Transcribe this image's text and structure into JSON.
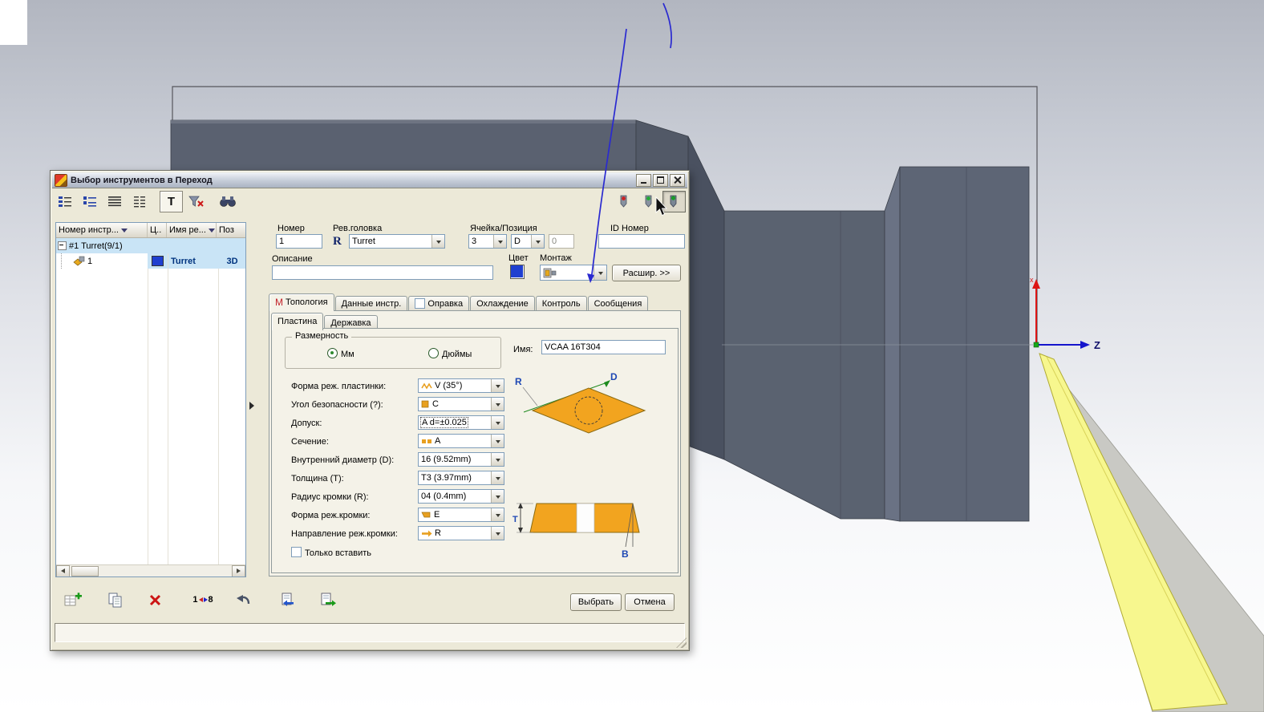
{
  "window": {
    "title": "Выбор инструментов в Переход"
  },
  "scene": {
    "z_label": "Z",
    "x_label": "x"
  },
  "toolbar": {
    "t_button": "T"
  },
  "tool_table": {
    "columns": [
      {
        "label": "Номер инстр..."
      },
      {
        "label": "Ц.."
      },
      {
        "label": "Имя ре..."
      },
      {
        "label": "Поз"
      }
    ],
    "group_row": "#1 Turret(9/1)",
    "tool_row": {
      "number": "1",
      "name": "Turret",
      "pos": "3D"
    }
  },
  "fields": {
    "number": {
      "label": "Номер",
      "value": "1"
    },
    "rev_head": {
      "label": "Рев.головка",
      "icon": "R",
      "value": "Turret"
    },
    "cell_pos": {
      "label": "Ячейка/Позиция",
      "cell": "3",
      "pos": "D",
      "extra": "0"
    },
    "id_number": {
      "label": "ID Номер",
      "value": ""
    },
    "description": {
      "label": "Описание",
      "value": ""
    },
    "color": {
      "label": "Цвет",
      "hex": "#1f3fd0"
    },
    "mount": {
      "label": "Монтаж"
    },
    "expand_button": "Расшир. >>"
  },
  "tabs": [
    {
      "label": "Топология",
      "icon": "M"
    },
    {
      "label": "Данные инстр."
    },
    {
      "label": "Оправка"
    },
    {
      "label": "Охлаждение"
    },
    {
      "label": "Контроль"
    },
    {
      "label": "Сообщения"
    }
  ],
  "subtabs": [
    {
      "label": "Пластина"
    },
    {
      "label": "Державка"
    }
  ],
  "insert_form": {
    "dimension_group": "Размерность",
    "mm": "Мм",
    "inches": "Дюймы",
    "name": {
      "label": "Имя:",
      "value": "VCAA 16T304"
    },
    "rows": [
      {
        "label": "Форма реж. пластинки:",
        "value": "V (35°)"
      },
      {
        "label": "Угол безопасности (?):",
        "value": "C"
      },
      {
        "label": "Допуск:",
        "value": "A d=±0.025"
      },
      {
        "label": "Сечение:",
        "value": "A"
      },
      {
        "label": "Внутренний диаметр (D):",
        "value": "16 (9.52mm)"
      },
      {
        "label": "Толщина (Т):",
        "value": "T3 (3.97mm)"
      },
      {
        "label": "Радиус кромки (R):",
        "value": "04 (0.4mm)"
      },
      {
        "label": "Форма реж.кромки:",
        "value": "E"
      },
      {
        "label": "Направление реж.кромки:",
        "value": "R"
      }
    ],
    "only_insert": "Только вставить",
    "diagram": {
      "r": "R",
      "d": "D",
      "t": "T",
      "b": "B"
    }
  },
  "bottom": {
    "renumber_left": "1",
    "renumber_right": "8",
    "select": "Выбрать",
    "cancel": "Отмена"
  },
  "colors": {
    "insert_orange": "#f2a41f",
    "selection_blue": "#c9e4f6",
    "part_gray": "#5a6170",
    "surface_yellow": "#f7f78e",
    "tool_color": "#1f3fd0"
  }
}
